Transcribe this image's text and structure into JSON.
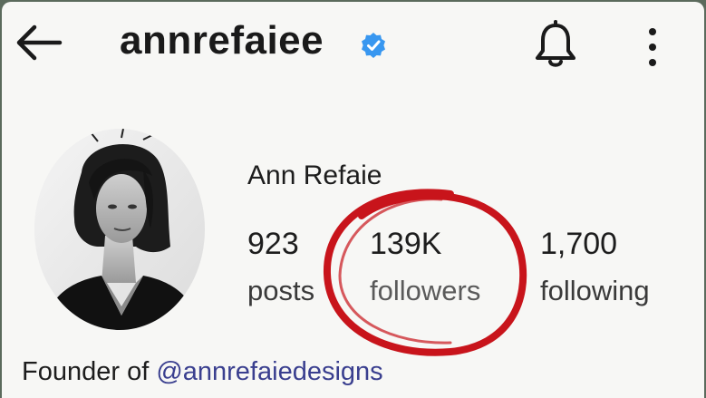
{
  "header": {
    "username": "annrefaiee",
    "verified": true,
    "icons": [
      "back-arrow-icon",
      "verified-badge-icon",
      "bell-icon",
      "more-vertical-icon"
    ]
  },
  "profile": {
    "display_name": "Ann Refaie",
    "stats": {
      "posts": {
        "value": "923",
        "label": "posts"
      },
      "followers": {
        "value": "139K",
        "label": "followers"
      },
      "following": {
        "value": "1,700",
        "label": "following"
      }
    },
    "bio": {
      "prefix": "Founder of ",
      "mention": "@annrefaiedesigns"
    }
  },
  "colors": {
    "verified_blue": "#3897f0",
    "annotation_red": "#c8141b",
    "mention": "#3a3f8f",
    "background": "#f7f7f5"
  }
}
